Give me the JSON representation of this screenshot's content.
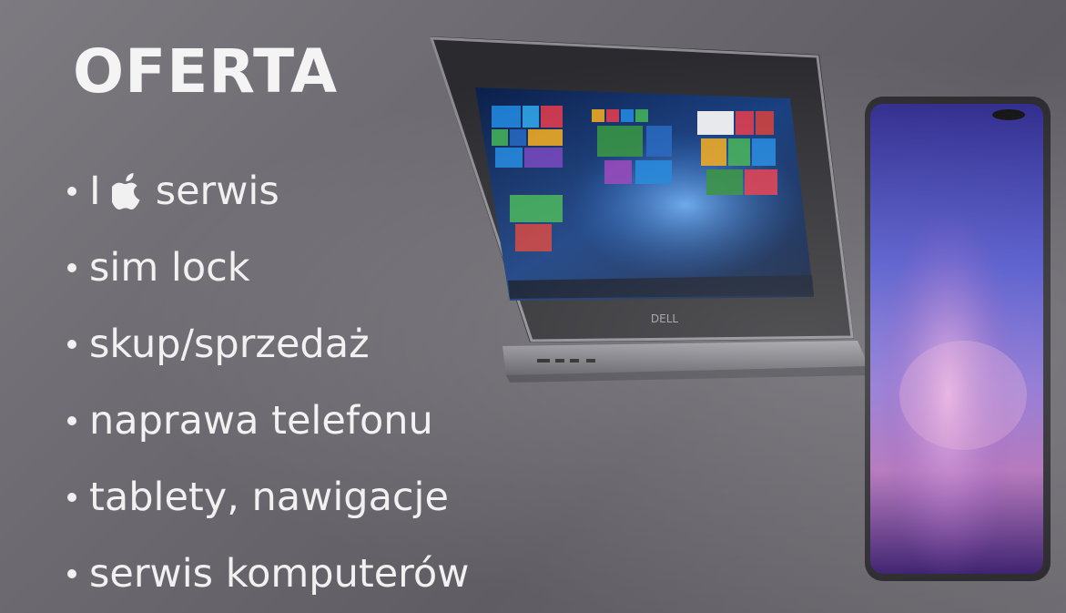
{
  "offer": {
    "title": "OFERTA",
    "items": [
      {
        "prefix": "I",
        "icon": "apple-logo-icon",
        "text": "serwis"
      },
      {
        "text": "sim lock"
      },
      {
        "text": "skup/sprzedaż"
      },
      {
        "text": "naprawa telefonu"
      },
      {
        "text": "tablety, nawigacje"
      },
      {
        "text": "serwis komputerów"
      }
    ]
  },
  "laptop": {
    "brand": "DELL"
  },
  "colors": {
    "text": "#f1f1f1",
    "background": "#6c6a70"
  }
}
